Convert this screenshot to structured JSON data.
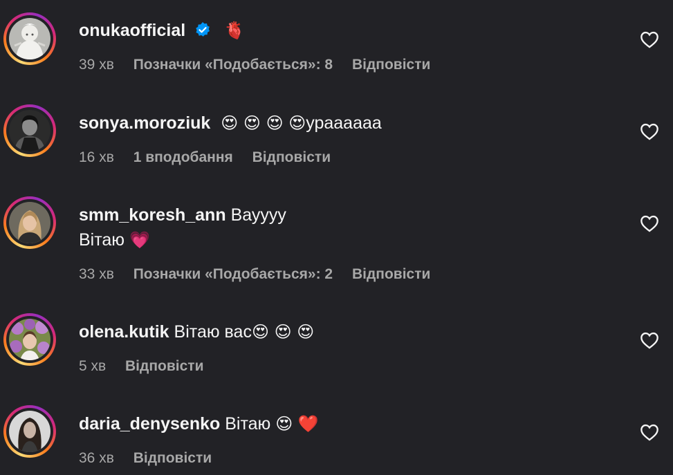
{
  "comments": [
    {
      "username": "onukaofficial",
      "verified": true,
      "text": "",
      "text_line2": "",
      "emoji_after": "🫀",
      "time": "39 хв",
      "likes": "Позначки «Подобається»: 8",
      "reply": "Відповісти",
      "avatar": "avatar-white-figure"
    },
    {
      "username": "sonya.moroziuk",
      "verified": false,
      "emoji_before": "😍 😍 😍 😍",
      "text": "урааааaa",
      "time": "16 хв",
      "likes": "1 вподобання",
      "reply": "Відповісти",
      "avatar": "avatar-bw-portrait"
    },
    {
      "username": "smm_koresh_ann",
      "verified": false,
      "text": "Вауууу",
      "text_line2": "Вітаю",
      "emoji_line2": "💗",
      "time": "33 хв",
      "likes": "Позначки «Подобається»: 2",
      "reply": "Відповісти",
      "avatar": "avatar-blonde-portrait"
    },
    {
      "username": "olena.kutik",
      "verified": false,
      "text": "Вітаю вас",
      "emoji_after": "😍 😍 😍",
      "time": "5 хв",
      "likes": "",
      "reply": "Відповісти",
      "avatar": "avatar-flowers-portrait"
    },
    {
      "username": "daria_denysenko",
      "verified": false,
      "text": "Вітаю",
      "emoji_after": "😍 ❤️",
      "time": "36 хв",
      "likes": "",
      "reply": "Відповісти",
      "avatar": "avatar-dark-hair-portrait"
    }
  ],
  "colors": {
    "background": "#222226",
    "text": "#f5f5f5",
    "meta": "#a8a8a8",
    "verified": "#0095f6",
    "story_ring": [
      "#feda75",
      "#fa7e1e",
      "#d62976",
      "#962fbf"
    ]
  },
  "icons": {
    "like": "heart-outline-icon",
    "verified": "verified-badge-icon"
  }
}
